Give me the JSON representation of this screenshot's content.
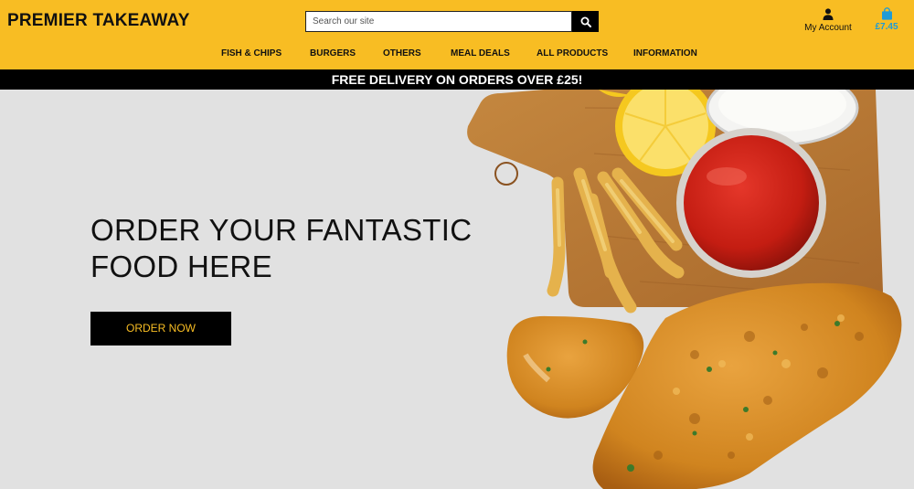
{
  "header": {
    "logo": "PREMIER TAKEAWAY",
    "search": {
      "placeholder": "Search our site",
      "icon": "search-icon"
    },
    "account": {
      "label": "My Account",
      "icon": "user-icon"
    },
    "cart": {
      "total": "£7.45",
      "icon": "shopping-bag-icon"
    },
    "nav": [
      {
        "label": "FISH & CHIPS"
      },
      {
        "label": "BURGERS"
      },
      {
        "label": "OTHERS"
      },
      {
        "label": "MEAL DEALS"
      },
      {
        "label": "ALL PRODUCTS"
      },
      {
        "label": "INFORMATION"
      }
    ]
  },
  "banner": {
    "text": "FREE DELIVERY ON ORDERS OVER £25!"
  },
  "hero": {
    "title_line1": "ORDER YOUR FANTASTIC",
    "title_line2": "FOOD HERE",
    "button": "ORDER NOW",
    "image": "fish-and-chips-photo"
  },
  "colors": {
    "brand_yellow": "#f8bd23",
    "black": "#000000",
    "cart_blue": "#1f9bd6",
    "hero_bg": "#e1e1e1"
  }
}
